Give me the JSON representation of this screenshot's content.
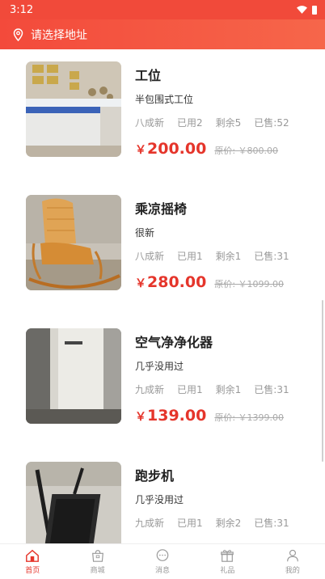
{
  "status": {
    "time": "3:12"
  },
  "header": {
    "location_placeholder": "请选择地址",
    "location_icon": "location-pin-icon"
  },
  "products": [
    {
      "title": "工位",
      "desc": "半包围式工位",
      "condition": "八成新",
      "used": "已用2",
      "remaining": "剩余5",
      "sold": "已售:52",
      "currency": "￥",
      "price": "200.00",
      "original": "原价: ￥800.00"
    },
    {
      "title": "乘凉摇椅",
      "desc": "很新",
      "condition": "八成新",
      "used": "已用1",
      "remaining": "剩余1",
      "sold": "已售:31",
      "currency": "￥",
      "price": "280.00",
      "original": "原价: ￥1099.00"
    },
    {
      "title": "空气净净化器",
      "desc": "几乎没用过",
      "condition": "九成新",
      "used": "已用1",
      "remaining": "剩余1",
      "sold": "已售:31",
      "currency": "￥",
      "price": "139.00",
      "original": "原价: ￥1399.00"
    },
    {
      "title": "跑步机",
      "desc": "几乎没用过",
      "condition": "九成新",
      "used": "已用1",
      "remaining": "剩余2",
      "sold": "已售:31",
      "currency": "￥",
      "price": "",
      "original": ""
    }
  ],
  "tabs": [
    {
      "label": "首页",
      "icon": "home-icon",
      "active": true
    },
    {
      "label": "商城",
      "icon": "shop-icon",
      "active": false
    },
    {
      "label": "消息",
      "icon": "message-icon",
      "active": false
    },
    {
      "label": "礼品",
      "icon": "gift-icon",
      "active": false
    },
    {
      "label": "我的",
      "icon": "user-icon",
      "active": false
    }
  ],
  "colors": {
    "accent": "#e5352b",
    "header_start": "#f34a3b",
    "header_end": "#f6664a"
  }
}
